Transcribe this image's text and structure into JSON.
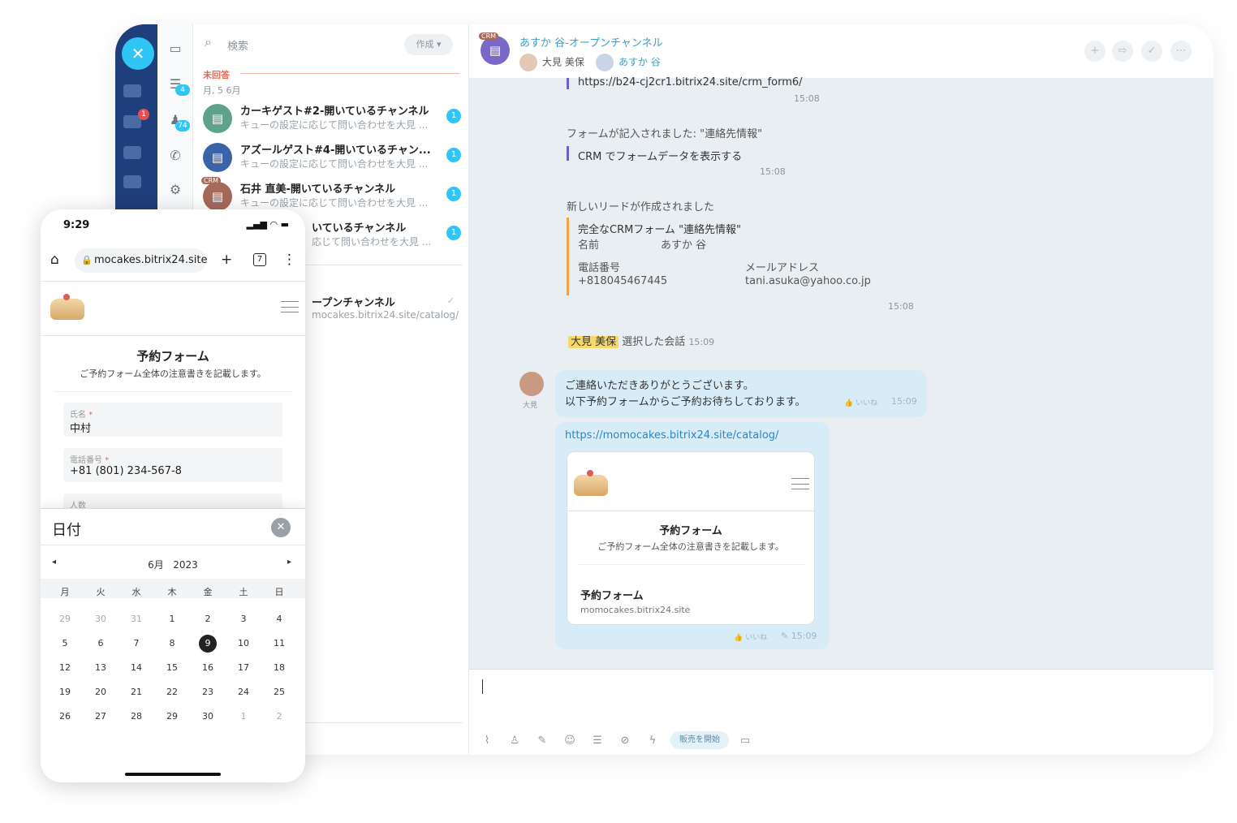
{
  "list": {
    "search_placeholder": "検索",
    "create_label": "作成",
    "section_label": "未回答",
    "section_date": "月, 5 6月",
    "rail_counts": [
      "4",
      "74"
    ],
    "rows": [
      {
        "title": "カーキゲスト#2-開いているチャンネル",
        "sub": "キューの設定に応じて問い合わせを大見 ...",
        "badge": "1"
      },
      {
        "title": "アズールゲスト#4-開いているチャン...",
        "sub": "キューの設定に応じて問い合わせを大見 ...",
        "badge": "1"
      },
      {
        "title": "石井 直美-開いているチャンネル",
        "sub": "キューの設定に応じて問い合わせを大見 ...",
        "badge": "1"
      },
      {
        "title": "いているチャンネル",
        "sub": "応じて問い合わせを大見 ...",
        "badge": "1"
      },
      {
        "title": "ープンチャンネル",
        "sub": "mocakes.bitrix24.site/catalog/"
      }
    ]
  },
  "chat": {
    "crm_badge": "CRM",
    "title": "あすか 谷-オープンチャンネル",
    "users": [
      "大見 美保",
      "あすか 谷"
    ],
    "url_top": "https://b24-cj2cr1.bitrix24.site/crm_form6/",
    "t1": "15:08",
    "form_filled": "フォームが記入されました: \"連絡先情報\"",
    "crm_view": "CRM でフォームデータを表示する",
    "t2": "15:08",
    "lead_created": "新しいリードが作成されました",
    "crm_form_line": "完全なCRMフォーム \"連絡先情報\"",
    "name_label": "名前",
    "name_value": "あすか 谷",
    "phone_label": "電話番号",
    "phone_value": "+818045467445",
    "email_label": "メールアドレス",
    "email_value": "tani.asuka@yahoo.co.jp",
    "t3": "15:08",
    "chosen_user": "大見 美保",
    "chosen_text": "選択した会話",
    "t4": "15:09",
    "operator_short": "大見",
    "msg_line1": "ご連絡いただきありがとうございます。",
    "msg_line2": "以下予約フォームからご予約お待ちしております。",
    "like": "いいね",
    "t5": "15:09",
    "link": "https://momocakes.bitrix24.site/catalog/",
    "card_title": "予約フォーム",
    "card_note": "ご予約フォーム全体の注意書きを記載します。",
    "card_footer_title": "予約フォーム",
    "card_footer_site": "momocakes.bitrix24.site",
    "t6": "15:09",
    "sales_button": "販売を開始"
  },
  "phone": {
    "time": "9:29",
    "url": "mocakes.bitrix24.site",
    "tabs_count": "7",
    "form_title": "予約フォーム",
    "form_note": "ご予約フォーム全体の注意書きを記載します。",
    "fields": [
      {
        "label": "氏名",
        "required": "*",
        "value": "中村"
      },
      {
        "label": "電話番号",
        "required": "*",
        "value": "+81 (801) 234-567-8"
      },
      {
        "label": "人数"
      }
    ],
    "picker": {
      "title": "日付",
      "month": "6月",
      "year": "2023",
      "weekdays": [
        "月",
        "火",
        "水",
        "木",
        "金",
        "土",
        "日"
      ],
      "weeks": [
        [
          "29",
          "30",
          "31",
          "1",
          "2",
          "3",
          "4"
        ],
        [
          "5",
          "6",
          "7",
          "8",
          "9",
          "10",
          "11"
        ],
        [
          "12",
          "13",
          "14",
          "15",
          "16",
          "17",
          "18"
        ],
        [
          "19",
          "20",
          "21",
          "22",
          "23",
          "24",
          "25"
        ],
        [
          "26",
          "27",
          "28",
          "29",
          "30",
          "1",
          "2"
        ]
      ],
      "selected": "9"
    }
  }
}
